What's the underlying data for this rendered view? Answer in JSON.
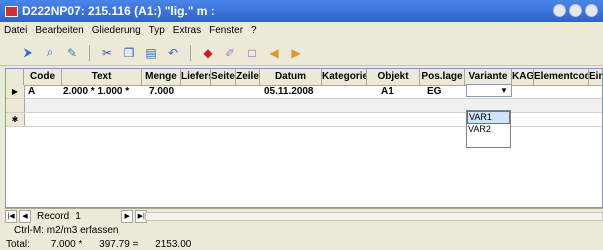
{
  "window": {
    "title": "D222NP07: 215.116   (A1:) \"lig.\" m  :"
  },
  "menu": [
    "Datei",
    "Bearbeiten",
    "Gliederung",
    "Typ",
    "Extras",
    "Fenster",
    "?"
  ],
  "toolbar": [
    "enter-icon",
    "search-icon",
    "edit-icon",
    "cut-icon",
    "copy-icon",
    "paste-icon",
    "undo-icon",
    "eraser-icon",
    "pencil-icon",
    "box-icon",
    "left-arrow-icon",
    "right-arrow-icon"
  ],
  "grid": {
    "columns": [
      "Code",
      "Text",
      "Menge",
      "Liefers",
      "Seite",
      "Zeile",
      "Datum",
      "Kategorie",
      "Objekt",
      "Pos.lage",
      "Variante",
      "KAG",
      "Elementcod",
      "Ein"
    ],
    "rows": [
      {
        "code": "A",
        "text": "2.000 *  1.000 *",
        "menge": "7.000",
        "datum": "05.11.2008",
        "objekt": "A1",
        "poslage": "EG"
      }
    ]
  },
  "dropdown": {
    "options": [
      "VAR1",
      "VAR2"
    ],
    "highlighted": "VAR1"
  },
  "nav": {
    "record_label": "Record",
    "record_number": "1"
  },
  "status": {
    "hint": "Ctrl-M: m2/m3 erfassen"
  },
  "totals": {
    "label": "Total:",
    "values": [
      "7.000 *",
      "397.79 =",
      "2153.00"
    ]
  }
}
